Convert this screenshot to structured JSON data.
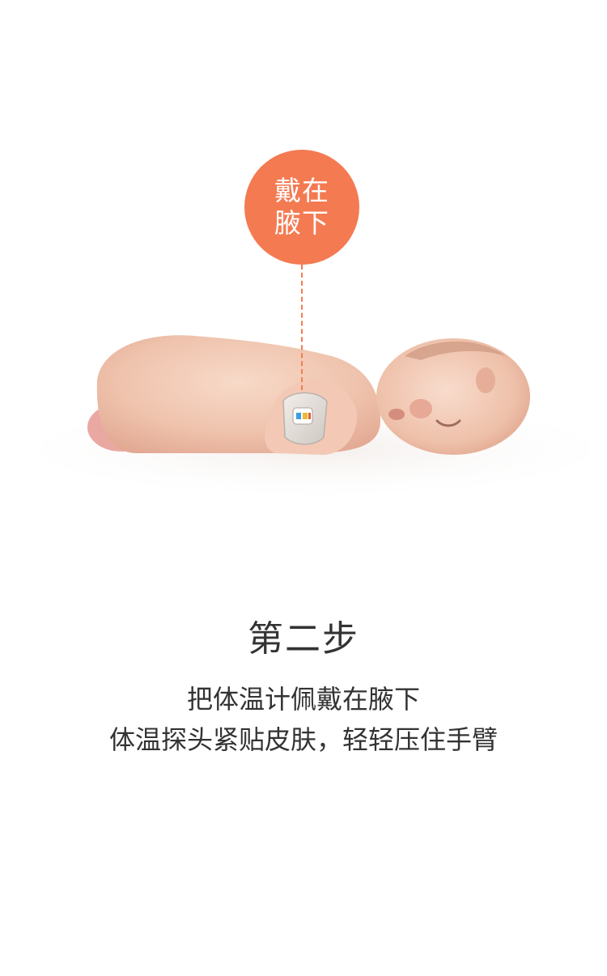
{
  "callout": {
    "text": "戴在腋下"
  },
  "step": {
    "title": "第二步",
    "lines": [
      "把体温计佩戴在腋下",
      "体温探头紧贴皮肤，轻轻压住手臂"
    ]
  },
  "colors": {
    "accent": "#f47a52",
    "text": "#333333",
    "background": "#ffffff"
  },
  "image": {
    "subject": "baby-sleeping-with-thermometer-icon"
  }
}
